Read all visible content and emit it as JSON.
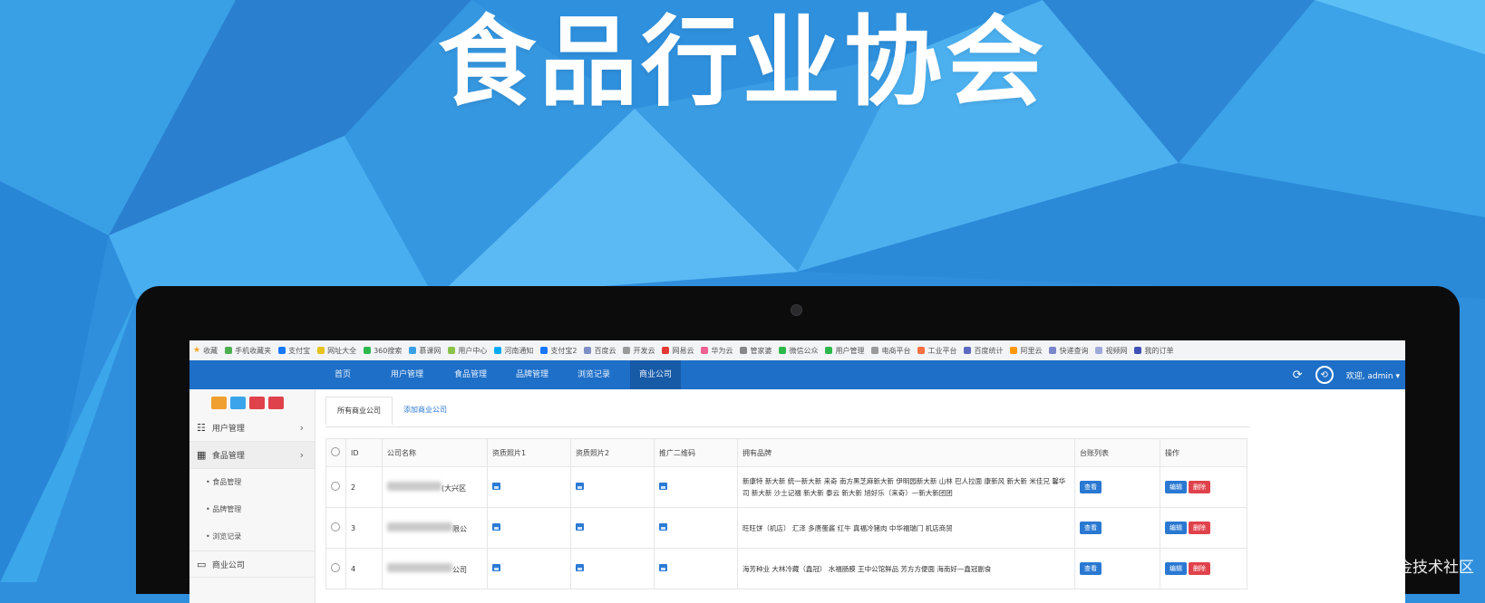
{
  "hero": {
    "title": "食品行业协会"
  },
  "watermark": "@稀土掘金技术社区",
  "colors": {
    "navbar": "#1e6fc7",
    "accent_blue": "#2a78d2",
    "danger_red": "#e0424b",
    "background": "#2f8fdc"
  },
  "app": {
    "nav": {
      "items": [
        "首页",
        "用户管理",
        "食品管理",
        "品牌管理",
        "浏览记录",
        "商业公司"
      ],
      "active_index": 5,
      "user_greeting": "欢迎, admin ▾",
      "refresh_icon": "refresh-icon",
      "avatar_icon": "avatar-icon"
    },
    "sidebar": {
      "items": [
        {
          "label": "用户管理",
          "icon": "users-icon"
        },
        {
          "label": "食品管理",
          "icon": "grid-icon"
        }
      ],
      "subitems": [
        "食品管理",
        "品牌管理",
        "浏览记录"
      ],
      "bottom_item": {
        "label": "商业公司",
        "icon": "monitor-icon"
      }
    },
    "tabs": {
      "list": "所有商业公司",
      "add": "添加商业公司"
    },
    "table": {
      "headers": [
        "ID",
        "公司名称",
        "资质照片1",
        "资质照片2",
        "推广二维码",
        "拥有品牌",
        "台账列表",
        "操作"
      ],
      "rows": [
        {
          "id": "2",
          "name_suffix": "(大兴区",
          "brands": "新康特 新大新 统一新大新 来奇 南方黑芝麻新大新 伊明园新大新 山林 巴人拉面 康新风 新大新 米佳兄 馨华司 新大新 沙土记福 新大新 泰云 新大新 旭好乐（来奇）—新大新团团"
        },
        {
          "id": "3",
          "name_suffix": "限公",
          "brands": "旺旺饼（机店） 汇泽 多唐蛋酱 红牛 真福冷猪肉 中华福瑞门 机店商贸"
        },
        {
          "id": "4",
          "name_suffix": "公司",
          "brands": "海芳种业 大林冷藏（鑫冠） 水福肠膜 王中公馆鲜品 芳方方便面 海南好—鑫冠副食"
        }
      ],
      "view_label": "查看",
      "edit_label": "编辑",
      "delete_label": "删除"
    },
    "bookmarks": [
      "收藏",
      "手机收藏夹",
      "支付宝",
      "网址大全",
      "360搜索",
      "慕课网",
      "用户中心",
      "河南通知",
      "支付宝2",
      "百度云",
      "开发云",
      "网易云",
      "华为云",
      "管家婆",
      "微信公众",
      "用户管理",
      "电商平台",
      "工业平台",
      "百度统计",
      "阿里云",
      "快递查询",
      "视频网",
      "我的订单"
    ]
  }
}
